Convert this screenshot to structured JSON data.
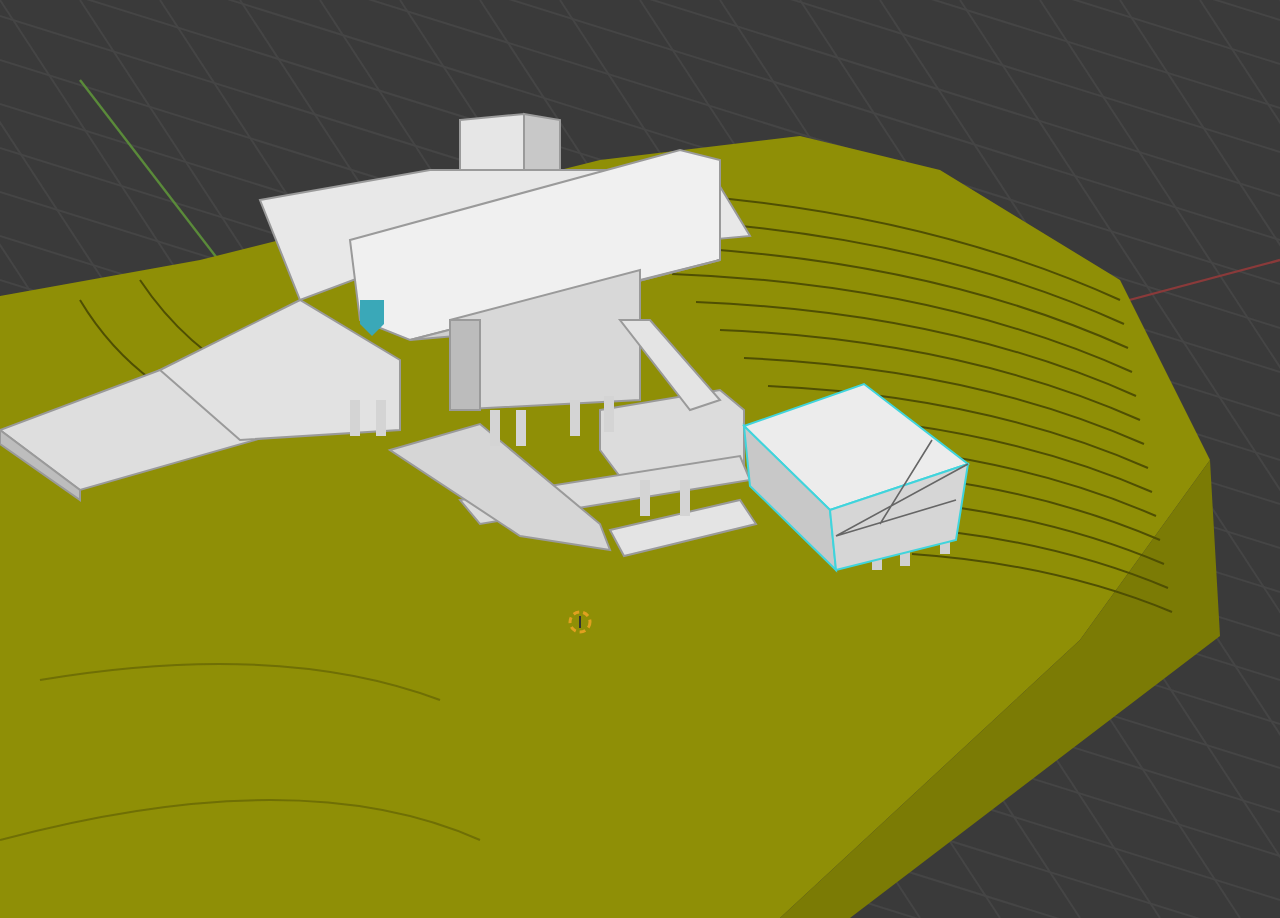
{
  "viewport": {
    "objects": [
      {
        "kind": "terrain",
        "selected": false
      },
      {
        "kind": "house",
        "selected": false
      },
      {
        "kind": "box",
        "selected": true
      }
    ],
    "cursor": true
  }
}
